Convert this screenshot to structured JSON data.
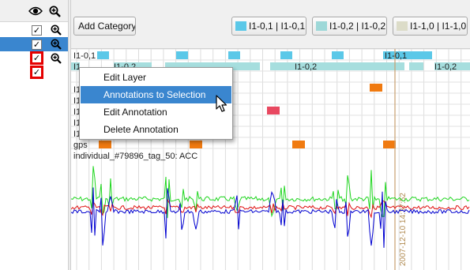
{
  "toolbar": {
    "add_category": "Add Category",
    "label_buttons": [
      {
        "text": "I1-0,1 | I1-0,1",
        "color": "#5bc8e8"
      },
      {
        "text": "I1-0,2 | I1-0,2",
        "color": "#9dd8d8"
      },
      {
        "text": "I1-1,0 | I1-1,0",
        "color": "#dcdcc8"
      }
    ]
  },
  "left_panel": {
    "header_icons": [
      "eye-icon",
      "zoom-in-icon"
    ],
    "rows": [
      {
        "checked": "✓",
        "selected": false,
        "highlight": false
      },
      {
        "checked": "✓",
        "selected": true,
        "highlight": false
      },
      {
        "checked": "✓",
        "selected": false,
        "highlight": true
      },
      {
        "checked": "✓",
        "selected": false,
        "highlight": true
      }
    ]
  },
  "timeline": {
    "tracks": [
      "I1-0,1",
      "I1",
      "I1",
      "I1",
      "I1",
      "I1",
      "I1",
      "gps"
    ],
    "segment_labels": [
      "I1-0,2",
      "I1-0,2",
      "I1-0,1",
      "I1-0,2"
    ],
    "signal_label": "individual_#79896_tag_50: ACC",
    "timestamp": "2007-12-10 14:37:52",
    "colors": {
      "ann_blue": "#5bc8e8",
      "ann_teal": "#a6dede",
      "ann_orange": "#f07a10",
      "ann_red": "#e84860",
      "acc_x": "#1fd61f",
      "acc_y": "#e01010",
      "acc_z": "#0000d0",
      "cursor_line": "#c8a070"
    }
  },
  "context_menu": {
    "items": [
      "Edit Layer",
      "Annotations to Selection",
      "Edit Annotation",
      "Delete Annotation"
    ],
    "active_index": 1
  }
}
